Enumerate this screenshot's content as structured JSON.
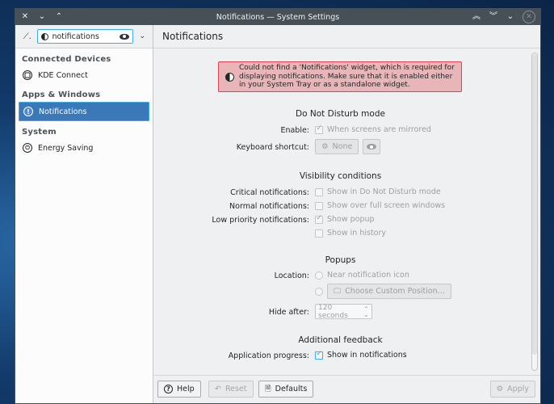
{
  "window": {
    "title": "Notifications — System Settings"
  },
  "sidebar": {
    "search_value": "notifications",
    "categories": [
      {
        "label": "Connected Devices",
        "items": [
          {
            "label": "KDE Connect",
            "icon": "kde-connect-icon",
            "selected": false
          }
        ]
      },
      {
        "label": "Apps & Windows",
        "items": [
          {
            "label": "Notifications",
            "icon": "notification-icon",
            "selected": true
          }
        ]
      },
      {
        "label": "System",
        "items": [
          {
            "label": "Energy Saving",
            "icon": "energy-saving-icon",
            "selected": false
          }
        ]
      }
    ]
  },
  "main": {
    "title": "Notifications",
    "error_message": "Could not find a 'Notifications' widget, which is required for displaying notifications. Make sure that it is enabled either in your System Tray or as a standalone widget.",
    "dnd": {
      "title": "Do Not Disturb mode",
      "enable_label": "Enable:",
      "enable_option": "When screens are mirrored",
      "enable_checked": true,
      "shortcut_label": "Keyboard shortcut:",
      "shortcut_value": "None"
    },
    "visibility": {
      "title": "Visibility conditions",
      "critical_label": "Critical notifications:",
      "critical_option": "Show in Do Not Disturb mode",
      "normal_label": "Normal notifications:",
      "normal_option": "Show over full screen windows",
      "low_label": "Low priority notifications:",
      "low_option_popup": "Show popup",
      "low_option_history": "Show in history"
    },
    "popups": {
      "title": "Popups",
      "location_label": "Location:",
      "location_option": "Near notification icon",
      "custom_position_button": "Choose Custom Position...",
      "hide_after_label": "Hide after:",
      "hide_after_value": "120 seconds"
    },
    "additional": {
      "title": "Additional feedback",
      "app_progress_label": "Application progress:",
      "app_progress_option": "Show in notifications",
      "app_progress_checked": true
    }
  },
  "footer": {
    "help": "Help",
    "reset": "Reset",
    "defaults": "Defaults",
    "apply": "Apply"
  }
}
